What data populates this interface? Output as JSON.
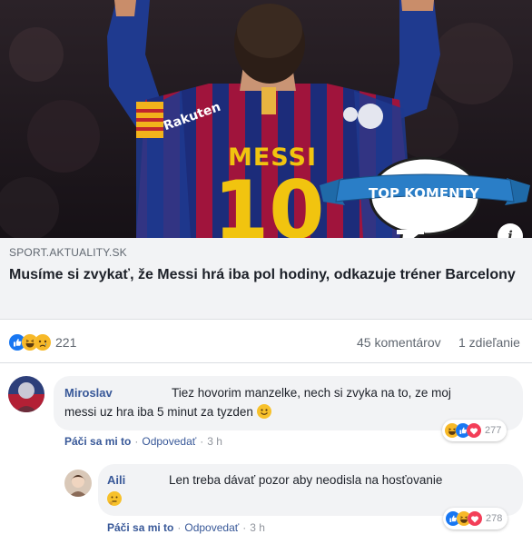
{
  "hero": {
    "jersey_name": "MESSI",
    "jersey_number": "10",
    "badge_text": "TOP KOMENTY",
    "sleeve_text": "Rakuten",
    "info_icon": "i"
  },
  "preview": {
    "domain": "SPORT.AKTUALITY.SK",
    "title": "Musíme si zvykať, že Messi hrá iba pol hodiny, odkazuje tréner Barcelony"
  },
  "stats": {
    "reaction_icons": [
      "like-icon",
      "haha-icon",
      "sad-icon"
    ],
    "reaction_count": "221",
    "comments": "45 komentárov",
    "shares": "1 zdieľanie"
  },
  "comments": [
    {
      "author": "Miroslav",
      "text_line1": "Tiez hovorim manzelke, nech si zvyka na to, ze moj",
      "text_line2": "messi uz hra iba 5 minut za tyzden",
      "text_emoji": "smile-emoji",
      "like_label": "Páči sa mi to",
      "reply_label": "Odpovedať",
      "time": "3 h",
      "reaction_icons": [
        "haha-icon",
        "like-icon",
        "love-icon"
      ],
      "reaction_count": "277"
    },
    {
      "author": "Aili",
      "text_line1": "Len treba dávať pozor aby neodisla na hosťovanie",
      "text_emoji": "thinking-emoji",
      "like_label": "Páči sa mi to",
      "reply_label": "Odpovedať",
      "time": "3 h",
      "reaction_icons": [
        "like-icon",
        "haha-icon",
        "love-icon"
      ],
      "reaction_count": "278"
    }
  ],
  "separator": "·",
  "colors": {
    "link_blue": "#385898",
    "muted_gray": "#606770",
    "like_blue": "#1877f2",
    "haha_yellow": "#f7b928",
    "love_red": "#f33e58",
    "badge_blue": "#2a7ec7"
  }
}
